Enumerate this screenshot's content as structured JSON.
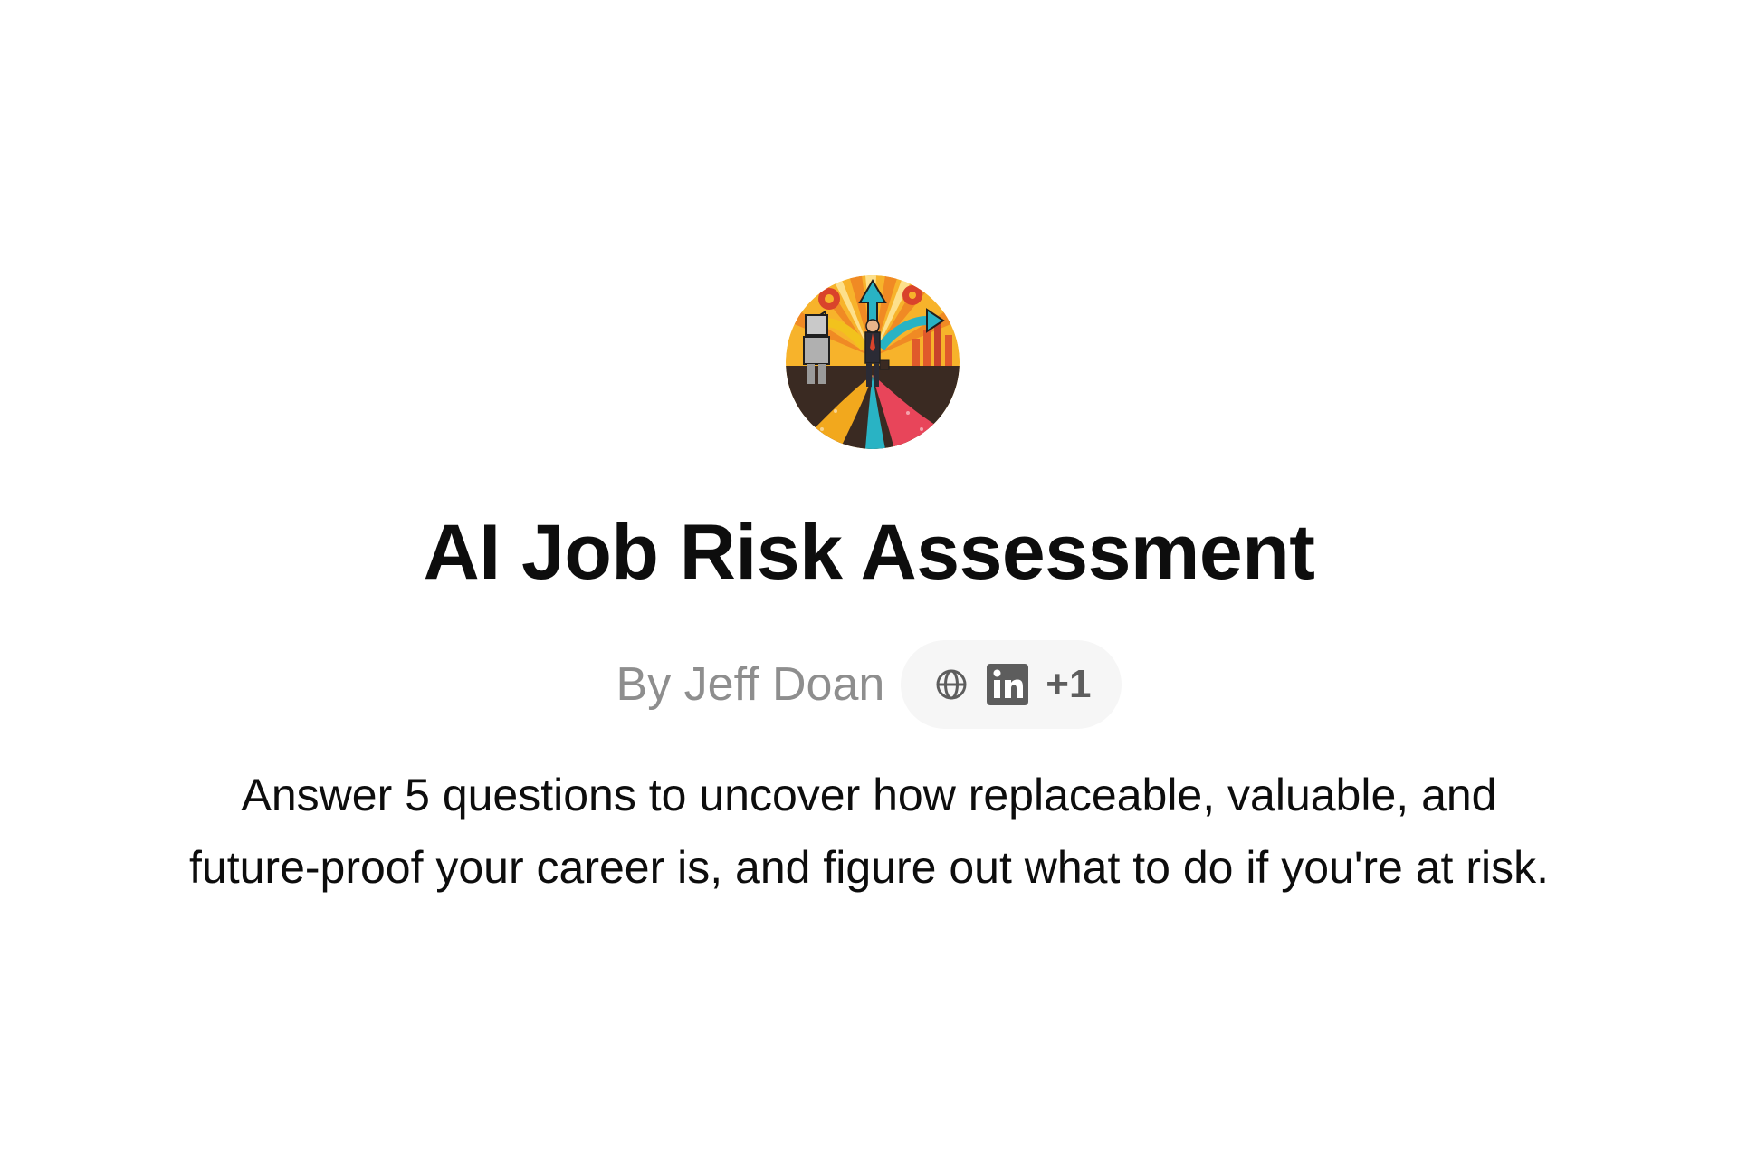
{
  "gpt": {
    "avatar_icon": "crossroads-career-illustration",
    "title": "AI Job Risk Assessment",
    "author": "By Jeff Doan",
    "links": {
      "website_icon": "globe-icon",
      "linkedin_icon": "linkedin-icon",
      "more_label": "+1"
    },
    "description_lines": [
      "Answer 5 questions to uncover how replaceable, valuable, and",
      "future-proof your career is, and figure out what to do if you're at risk."
    ]
  }
}
